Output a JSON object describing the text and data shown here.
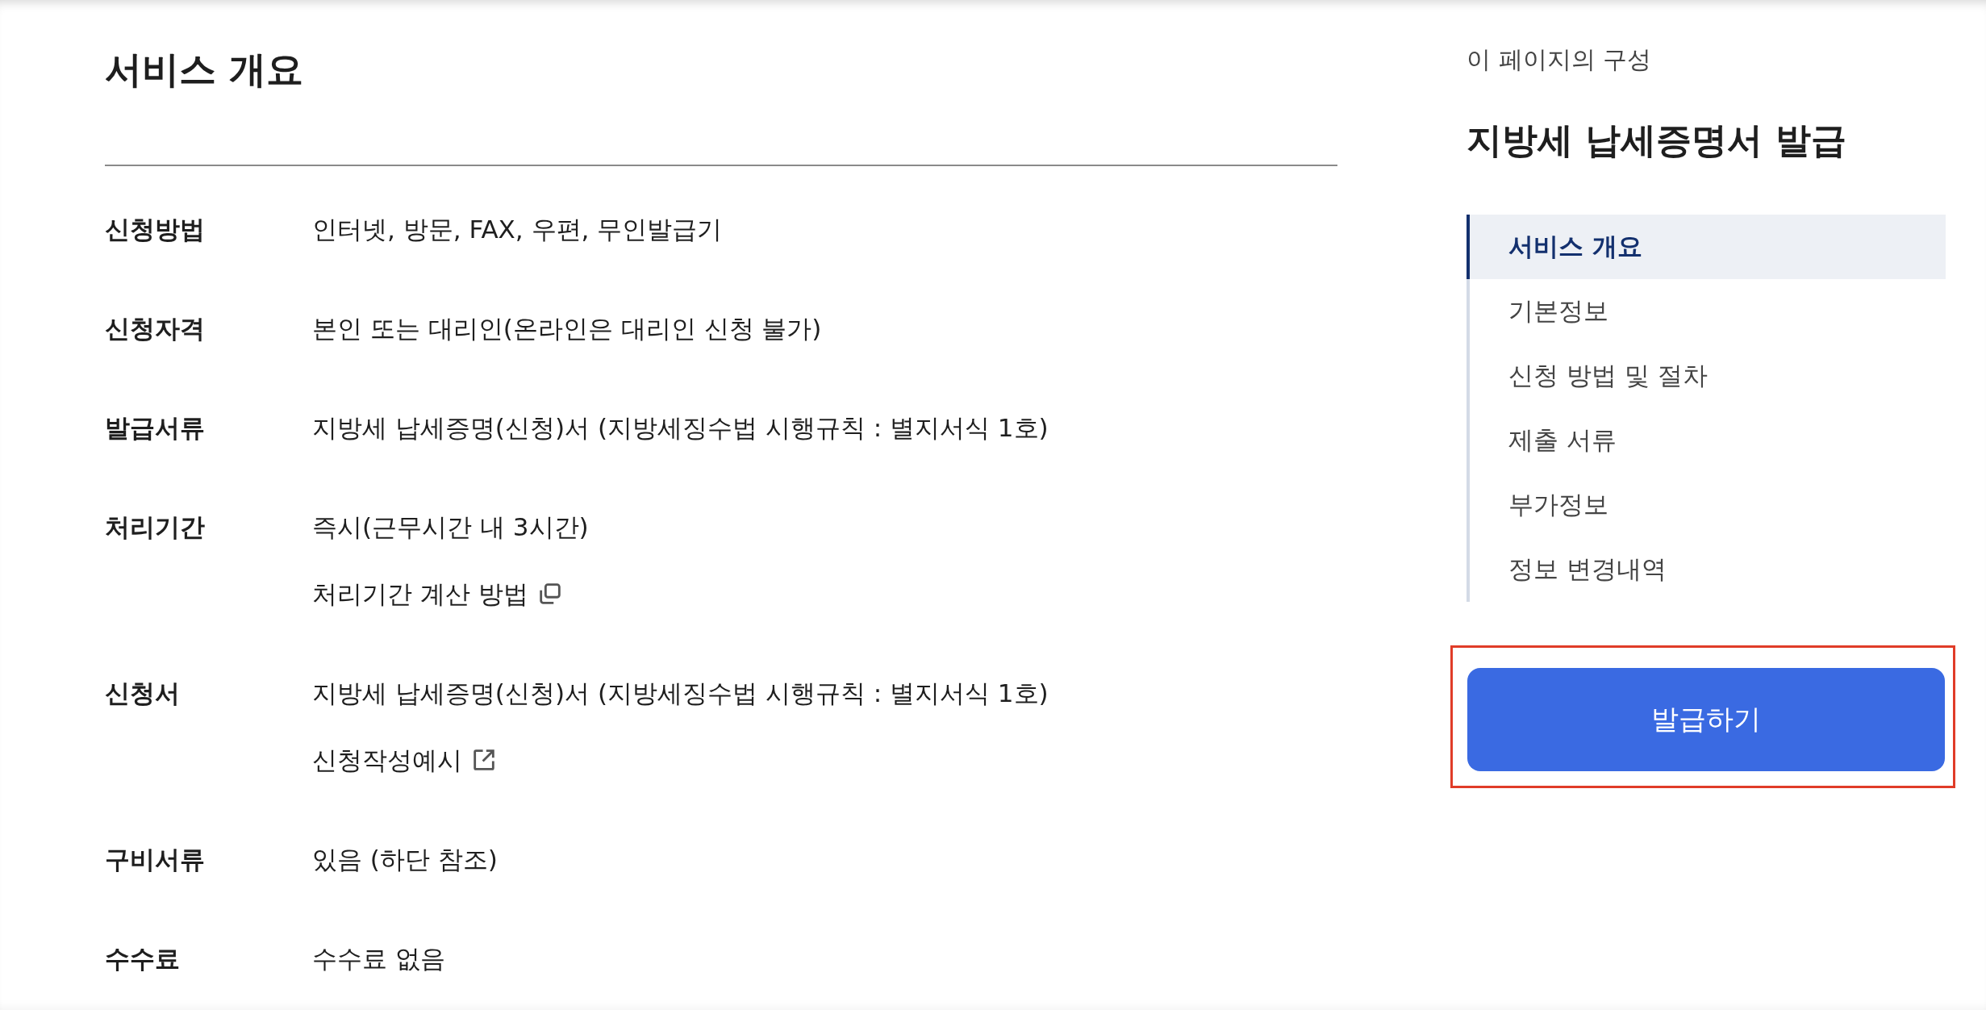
{
  "main": {
    "title": "서비스 개요",
    "rows": [
      {
        "label": "신청방법",
        "lines": [
          {
            "kind": "text",
            "text": "인터넷, 방문, FAX, 우편, 무인발급기"
          }
        ]
      },
      {
        "label": "신청자격",
        "lines": [
          {
            "kind": "text",
            "text": "본인 또는 대리인(온라인은 대리인 신청 불가)"
          }
        ]
      },
      {
        "label": "발급서류",
        "lines": [
          {
            "kind": "text",
            "text": "지방세 납세증명(신청)서 (지방세징수법 시행규칙 : 별지서식 1호)"
          }
        ]
      },
      {
        "label": "처리기간",
        "lines": [
          {
            "kind": "text",
            "text": "즉시(근무시간 내 3시간)"
          },
          {
            "kind": "popup-link",
            "text": "처리기간 계산 방법"
          }
        ]
      },
      {
        "label": "신청서",
        "lines": [
          {
            "kind": "text",
            "text": "지방세 납세증명(신청)서 (지방세징수법 시행규칙 : 별지서식 1호)"
          },
          {
            "kind": "external-link",
            "text": "신청작성예시"
          }
        ]
      },
      {
        "label": "구비서류",
        "lines": [
          {
            "kind": "text",
            "text": "있음 (하단 참조)"
          }
        ]
      },
      {
        "label": "수수료",
        "lines": [
          {
            "kind": "text",
            "text": "수수료 없음"
          }
        ]
      }
    ]
  },
  "aside": {
    "caption": "이 페이지의 구성",
    "title": "지방세 납세증명서 발급",
    "nav": [
      {
        "label": "서비스 개요",
        "selected": true
      },
      {
        "label": "기본정보",
        "selected": false
      },
      {
        "label": "신청 방법 및 절차",
        "selected": false
      },
      {
        "label": "제출 서류",
        "selected": false
      },
      {
        "label": "부가정보",
        "selected": false
      },
      {
        "label": "정보 변경내역",
        "selected": false
      }
    ],
    "button": {
      "label": "발급하기",
      "highlighted": true
    }
  }
}
